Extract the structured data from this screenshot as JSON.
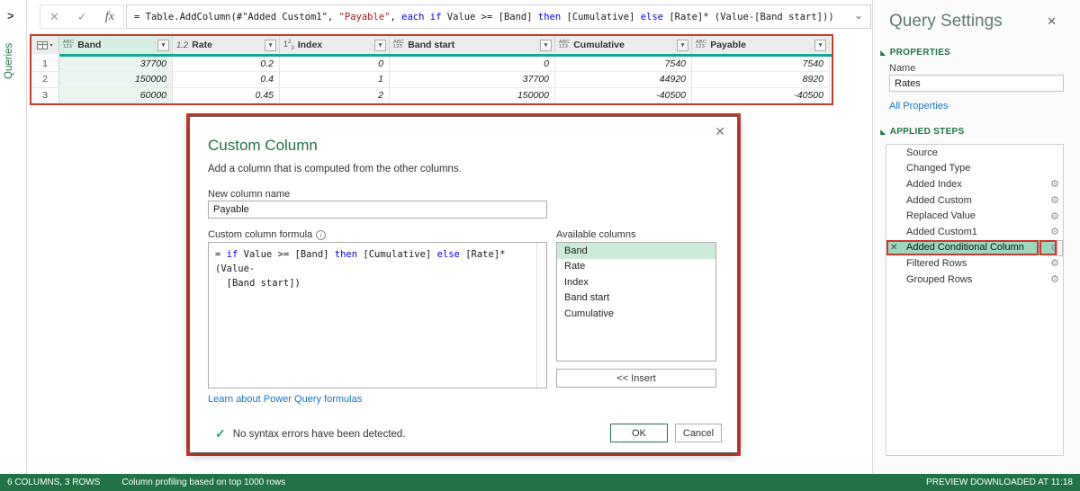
{
  "colors": {
    "excel_green": "#217346",
    "teal_accent": "#14a694",
    "annotation_red": "#c73b2d",
    "selection_green": "#9fd6be",
    "link_blue": "#1673c6",
    "keyword_blue": "#0000e0",
    "string_red": "#a31515"
  },
  "icons": {
    "expand_chevron": ">",
    "cancel": "✕",
    "check": "✓",
    "fx": "fx",
    "dropdown_chevron": "⌄",
    "column_dropdown": "▾",
    "close": "✕",
    "gear": "⚙",
    "section_triangle": "◢",
    "success_check": "✓",
    "delete": "✕",
    "info": "i"
  },
  "queries_pane": {
    "label": "Queries"
  },
  "formula_bar": {
    "tokens": [
      {
        "t": "= Table.AddColumn(#\"Added Custom1\", ",
        "c": "n"
      },
      {
        "t": "\"Payable\"",
        "c": "s"
      },
      {
        "t": ", ",
        "c": "n"
      },
      {
        "t": "each",
        "c": "k"
      },
      {
        "t": " ",
        "c": "n"
      },
      {
        "t": "if",
        "c": "k"
      },
      {
        "t": " Value >= [Band] ",
        "c": "n"
      },
      {
        "t": "then",
        "c": "k"
      },
      {
        "t": " [Cumulative] ",
        "c": "n"
      },
      {
        "t": "else",
        "c": "k"
      },
      {
        "t": " [Rate]* (Value-[Band start]))",
        "c": "n"
      }
    ]
  },
  "grid": {
    "columns": [
      {
        "name": "Band",
        "type": "abc123",
        "selected": true
      },
      {
        "name": "Rate",
        "type": "decimal",
        "selected": false
      },
      {
        "name": "Index",
        "type": "whole",
        "selected": false
      },
      {
        "name": "Band start",
        "type": "abc123",
        "selected": false
      },
      {
        "name": "Cumulative",
        "type": "abc123",
        "selected": false
      },
      {
        "name": "Payable",
        "type": "abc123",
        "selected": false
      }
    ],
    "rows": [
      {
        "num": "1",
        "cells": [
          "37700",
          "0.2",
          "0",
          "0",
          "7540",
          "7540"
        ]
      },
      {
        "num": "2",
        "cells": [
          "150000",
          "0.4",
          "1",
          "37700",
          "44920",
          "8920"
        ]
      },
      {
        "num": "3",
        "cells": [
          "60000",
          "0.45",
          "2",
          "150000",
          "-40500",
          "-40500"
        ]
      }
    ]
  },
  "dialog": {
    "title": "Custom Column",
    "subtitle": "Add a column that is computed from the other columns.",
    "name_label": "New column name",
    "name_value": "Payable",
    "formula_label": "Custom column formula",
    "formula_tokens": [
      {
        "t": "= ",
        "c": "n"
      },
      {
        "t": "if",
        "c": "k"
      },
      {
        "t": " Value >= [Band] ",
        "c": "n"
      },
      {
        "t": "then",
        "c": "k"
      },
      {
        "t": " [Cumulative] ",
        "c": "n"
      },
      {
        "t": "else",
        "c": "k"
      },
      {
        "t": " [Rate]* (Value-\n  [Band start])",
        "c": "n"
      }
    ],
    "available_label": "Available columns",
    "available_columns": [
      {
        "name": "Band",
        "selected": true
      },
      {
        "name": "Rate",
        "selected": false
      },
      {
        "name": "Index",
        "selected": false
      },
      {
        "name": "Band start",
        "selected": false
      },
      {
        "name": "Cumulative",
        "selected": false
      }
    ],
    "insert_label": "<< Insert",
    "link": "Learn about Power Query formulas",
    "status_message": "No syntax errors have been detected.",
    "ok_label": "OK",
    "cancel_label": "Cancel"
  },
  "query_settings": {
    "title": "Query Settings",
    "properties_header": "PROPERTIES",
    "name_label": "Name",
    "name_value": "Rates",
    "all_properties_link": "All Properties",
    "applied_steps_header": "APPLIED STEPS",
    "steps": [
      {
        "label": "Source",
        "gear": false,
        "selected": false
      },
      {
        "label": "Changed Type",
        "gear": false,
        "selected": false
      },
      {
        "label": "Added Index",
        "gear": true,
        "selected": false
      },
      {
        "label": "Added Custom",
        "gear": true,
        "selected": false
      },
      {
        "label": "Replaced Value",
        "gear": true,
        "selected": false
      },
      {
        "label": "Added Custom1",
        "gear": true,
        "selected": false
      },
      {
        "label": "Added Conditional Column",
        "gear": true,
        "selected": true,
        "annotated": true
      },
      {
        "label": "Filtered Rows",
        "gear": true,
        "selected": false
      },
      {
        "label": "Grouped Rows",
        "gear": true,
        "selected": false
      }
    ]
  },
  "status_bar": {
    "left_primary": "6 COLUMNS, 3 ROWS",
    "left_secondary": "Column profiling based on top 1000 rows",
    "right": "PREVIEW DOWNLOADED AT 11:18"
  }
}
